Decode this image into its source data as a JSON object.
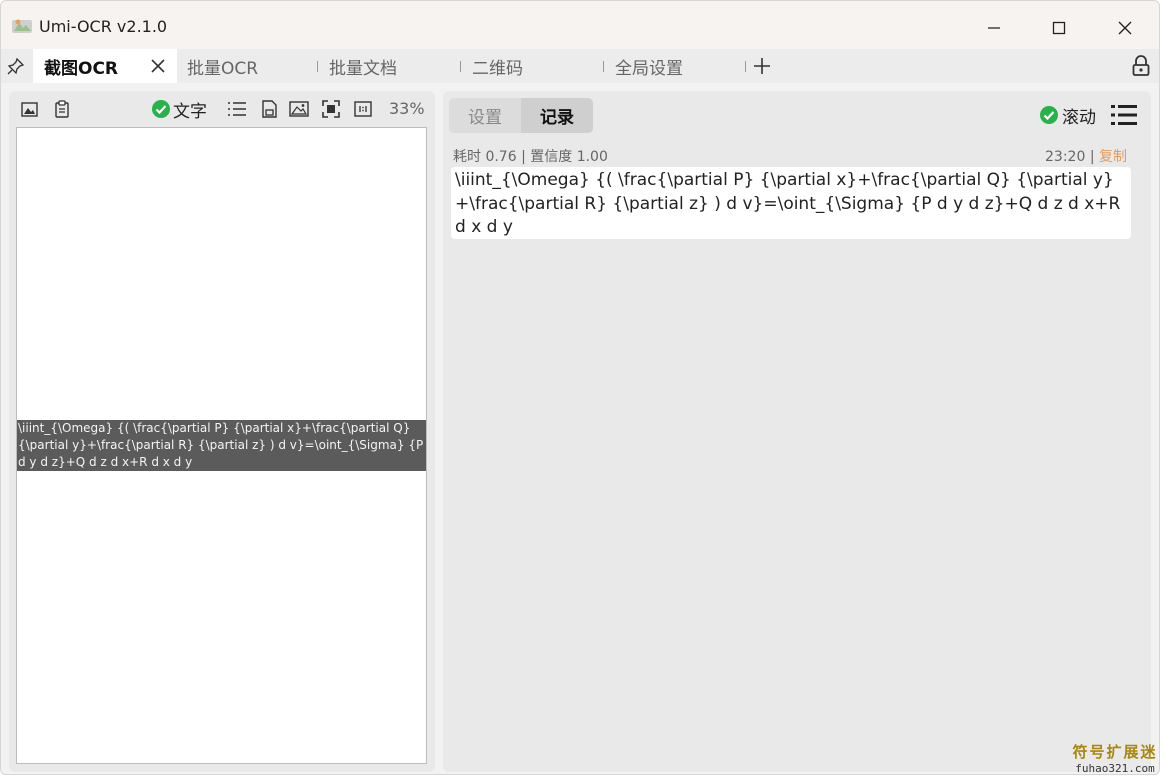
{
  "window": {
    "title": "Umi-OCR v2.1.0"
  },
  "tabs": [
    {
      "label": "截图OCR"
    },
    {
      "label": "批量OCR"
    },
    {
      "label": "批量文档"
    },
    {
      "label": "二维码"
    },
    {
      "label": "全局设置"
    }
  ],
  "left_toolbar": {
    "text_toggle_label": "文字",
    "text_toggle_checked": true,
    "zoom": "33%"
  },
  "preview": {
    "overlay_text": "\\iiint_{\\Omega} {( \\frac{\\partial P} {\\partial x}+\\frac{\\partial Q} {\\partial y}+\\frac{\\partial R} {\\partial z} ) d v}=\\oint_{\\Sigma} {P d y d z}+Q d z d x+R d x d y"
  },
  "right_tabs": [
    {
      "label": "设置"
    },
    {
      "label": "记录"
    }
  ],
  "right_toolbar": {
    "scroll_label": "滚动",
    "scroll_checked": true
  },
  "record": {
    "meta": "耗时 0.76 | 置信度 1.00",
    "time": "23:20",
    "copy_label": "复制",
    "text": "\\iiint_{\\Omega} {( \\frac{\\partial P} {\\partial x}+\\frac{\\partial Q} {\\partial y}+\\frac{\\partial R} {\\partial z} ) d v}=\\oint_{\\Sigma} {P d y d z}+Q d z d x+R d x d y"
  },
  "watermark": {
    "cn": "符号扩展迷",
    "en": "fuhao321.com"
  },
  "colors": {
    "accent_green": "#27b24a",
    "copy_orange": "#e69b5a",
    "overlay_bg": "#5b5b5b"
  }
}
